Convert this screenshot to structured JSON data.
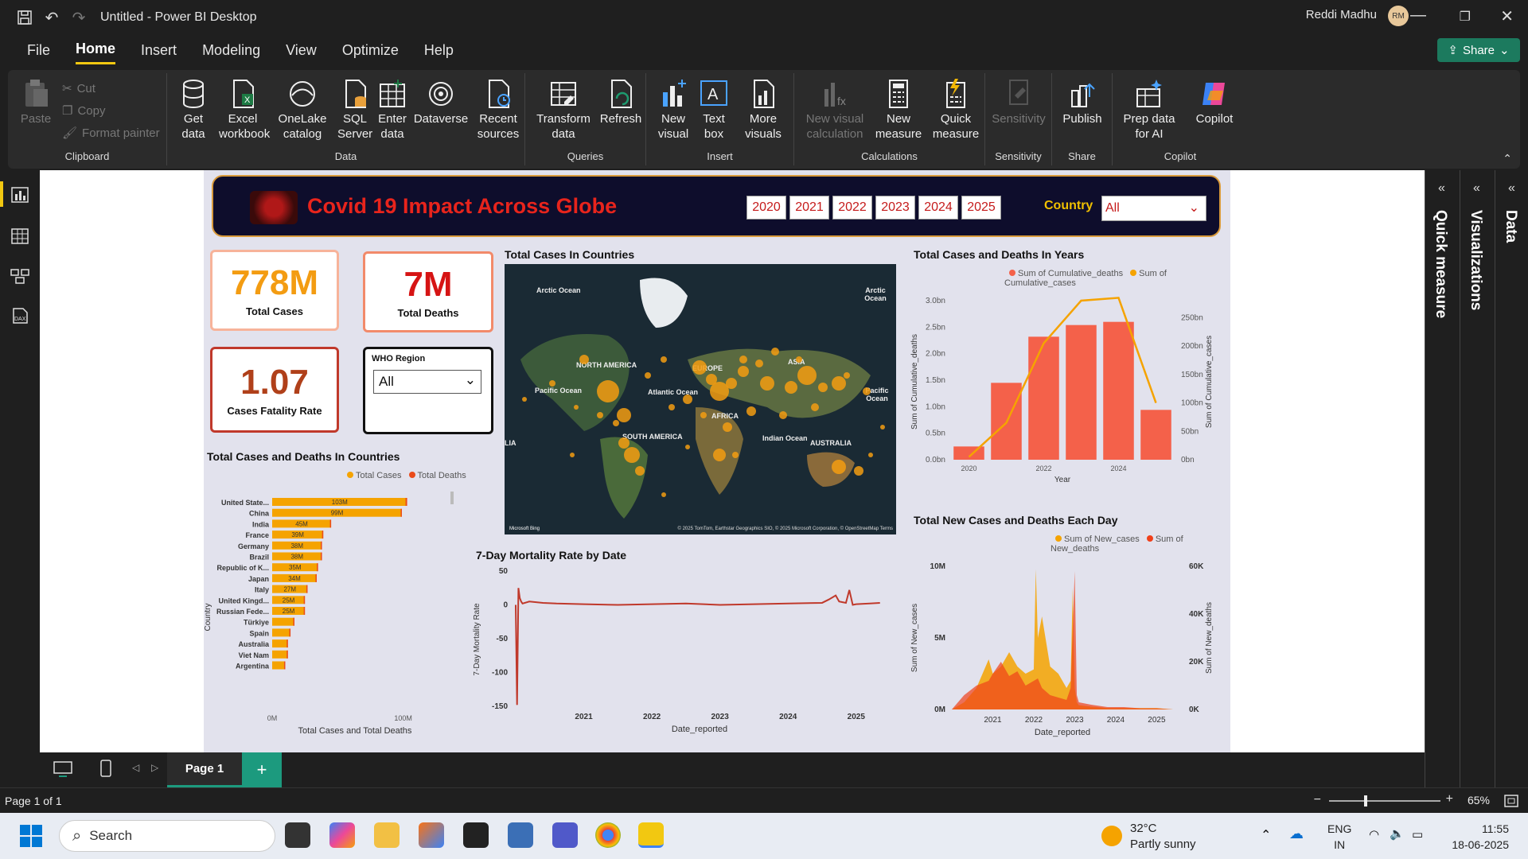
{
  "window": {
    "title": "Untitled - Power BI Desktop",
    "user": "Reddi Madhu",
    "initials": "RM"
  },
  "menu": [
    "File",
    "Home",
    "Insert",
    "Modeling",
    "View",
    "Optimize",
    "Help"
  ],
  "share_label": "Share",
  "ribbon": {
    "clipboard": {
      "paste": "Paste",
      "cut": "Cut",
      "copy": "Copy",
      "format_painter": "Format painter",
      "label": "Clipboard"
    },
    "data": {
      "get_data": "Get data",
      "excel": "Excel workbook",
      "onelake": "OneLake catalog",
      "sql": "SQL Server",
      "enter": "Enter data",
      "dataverse": "Dataverse",
      "recent": "Recent sources",
      "label": "Data"
    },
    "queries": {
      "transform": "Transform data",
      "refresh": "Refresh",
      "label": "Queries"
    },
    "insert": {
      "new_visual": "New visual",
      "text_box": "Text box",
      "more_visuals": "More visuals",
      "label": "Insert"
    },
    "calculations": {
      "new_visual_calc": "New visual calculation",
      "new_measure": "New measure",
      "quick_measure": "Quick measure",
      "label": "Calculations"
    },
    "sensitivity": {
      "btn": "Sensitivity",
      "label": "Sensitivity"
    },
    "share": {
      "publish": "Publish",
      "label": "Share"
    },
    "copilot": {
      "prep": "Prep data for AI",
      "copilot": "Copilot",
      "label": "Copilot"
    }
  },
  "panes": [
    "Quick measure",
    "Visualizations",
    "Data"
  ],
  "report": {
    "title": "Covid 19 Impact Across Globe",
    "years": [
      "2020",
      "2021",
      "2022",
      "2023",
      "2024",
      "2025"
    ],
    "country_label": "Country",
    "country_value": "All",
    "cards": [
      {
        "value": "778M",
        "label": "Total Cases",
        "color": "#f39c12"
      },
      {
        "value": "7M",
        "label": "Total Deaths",
        "color": "#d61414"
      },
      {
        "value": "1.07",
        "label": "Cases Fatality Rate",
        "color": "#b0401a"
      }
    ],
    "who_label": "WHO Region",
    "who_value": "All",
    "map": {
      "title": "Total Cases In Countries",
      "labels": [
        "Arctic Ocean",
        "Arctic Ocean",
        "NORTH AMERICA",
        "EUROPE",
        "ASIA",
        "Pacific Ocean",
        "Atlantic Ocean",
        "Pacific Ocean",
        "AFRICA",
        "SOUTH AMERICA",
        "Indian Ocean",
        "AUSTRALIA",
        "LIA"
      ],
      "attribution": "© 2025 TomTom, Earthstar Geographics SIO, © 2025 Microsoft Corporation, © OpenStreetMap Terms",
      "bing": "Microsoft Bing"
    }
  },
  "chart_data": [
    {
      "type": "bar",
      "title": "Total Cases and Deaths In Countries",
      "orientation": "horizontal",
      "legend": [
        "Total Cases",
        "Total Deaths"
      ],
      "categories": [
        "United State...",
        "China",
        "India",
        "France",
        "Germany",
        "Brazil",
        "Republic of K...",
        "Japan",
        "Italy",
        "United Kingd...",
        "Russian Fede...",
        "Türkiye",
        "Spain",
        "Australia",
        "Viet Nam",
        "Argentina"
      ],
      "series": [
        {
          "name": "Total Cases",
          "values": [
            103,
            99,
            45,
            39,
            38,
            38,
            35,
            34,
            27,
            25,
            25,
            17,
            14,
            12,
            12,
            10
          ]
        },
        {
          "name": "Total Deaths",
          "values": [
            1.2,
            0.12,
            0.53,
            0.17,
            0.18,
            0.7,
            0.04,
            0.07,
            0.2,
            0.23,
            0.4,
            0.1,
            0.12,
            0.02,
            0.04,
            0.13
          ]
        }
      ],
      "data_labels": [
        "103M",
        "99M",
        "45M",
        "39M",
        "38M",
        "38M",
        "35M",
        "34M",
        "27M",
        "25M",
        "25M",
        "",
        "",
        "",
        "",
        ""
      ],
      "xlabel": "Total Cases and Total Deaths",
      "ylabel": "Country",
      "xticks": [
        "0M",
        "100M"
      ],
      "xlim": [
        0,
        130
      ],
      "colors": {
        "cases": "#f5a300",
        "deaths": "#ea4b1b"
      }
    },
    {
      "type": "bar",
      "title": "Total Cases and Deaths In Years",
      "legend": [
        "Sum of Cumulative_deaths",
        "Sum of Cumulative_cases"
      ],
      "categories": [
        2020,
        2021,
        2022,
        2023,
        2024,
        2025
      ],
      "series": [
        {
          "name": "Sum of Cumulative_deaths",
          "kind": "bar",
          "values": [
            0.25,
            1.45,
            2.32,
            2.54,
            2.6,
            0.94
          ]
        },
        {
          "name": "Sum of Cumulative_cases",
          "kind": "line",
          "values": [
            5,
            65,
            205,
            280,
            285,
            100
          ]
        }
      ],
      "xlabel": "Year",
      "ylabel": "Sum of Cumulative_deaths",
      "y2label": "Sum of Cumulative_cases",
      "xticks": [
        "2020",
        "2022",
        "2024"
      ],
      "yticks": [
        "0.0bn",
        "0.5bn",
        "1.0bn",
        "1.5bn",
        "2.0bn",
        "2.5bn",
        "3.0bn"
      ],
      "y2ticks": [
        "0bn",
        "50bn",
        "100bn",
        "150bn",
        "200bn",
        "250bn"
      ],
      "ylim": [
        0,
        3.0
      ],
      "y2lim": [
        0,
        280
      ],
      "colors": {
        "bar": "#f4614a",
        "line": "#f5a300"
      }
    },
    {
      "type": "line",
      "title": "7-Day Mortality Rate by Date",
      "xlabel": "Date_reported",
      "ylabel": "7-Day Mortality Rate",
      "xticks": [
        "2021",
        "2022",
        "2023",
        "2024",
        "2025"
      ],
      "yticks": [
        "50",
        "0",
        "-50",
        "-100",
        "-150"
      ],
      "ylim": [
        -150,
        50
      ],
      "x": [
        2020.0,
        2020.02,
        2020.04,
        2020.06,
        2020.08,
        2020.1,
        2020.2,
        2020.4,
        2020.6,
        2021.0,
        2021.5,
        2022.0,
        2022.5,
        2023.0,
        2023.5,
        2024.0,
        2024.5,
        2024.6,
        2024.7,
        2024.75,
        2024.8,
        2024.85,
        2024.9,
        2024.95,
        2025.0,
        2025.2,
        2025.35
      ],
      "y": [
        0,
        -148,
        25,
        10,
        5,
        2,
        5,
        3,
        2,
        1,
        0,
        1,
        2,
        0,
        1,
        2,
        3,
        8,
        14,
        5,
        4,
        3,
        22,
        0,
        1,
        2,
        3
      ],
      "color": "#c0392b"
    },
    {
      "type": "area",
      "title": "Total New Cases and Deaths Each Day",
      "legend": [
        "Sum of New_cases",
        "Sum of New_deaths"
      ],
      "xlabel": "Date_reported",
      "ylabel": "Sum of New_cases",
      "y2label": "Sum of New_deaths",
      "xticks": [
        "2021",
        "2022",
        "2023",
        "2024",
        "2025"
      ],
      "yticks": [
        "0M",
        "5M",
        "10M"
      ],
      "y2ticks": [
        "0K",
        "20K",
        "40K",
        "60K"
      ],
      "ylim": [
        0,
        10
      ],
      "y2lim": [
        0,
        60
      ],
      "series": [
        {
          "name": "Sum of New_cases",
          "x": [
            2020.0,
            2020.3,
            2020.6,
            2020.9,
            2021.0,
            2021.2,
            2021.4,
            2021.6,
            2021.8,
            2022.0,
            2022.05,
            2022.1,
            2022.2,
            2022.4,
            2022.6,
            2022.8,
            2022.9,
            2022.95,
            2023.0,
            2023.05,
            2023.1,
            2023.4,
            2023.8,
            2024.2,
            2024.6,
            2025.0,
            2025.4
          ],
          "values": [
            0,
            0.5,
            1.5,
            3.5,
            2.5,
            3.0,
            4.0,
            3.0,
            2.5,
            2.8,
            9.8,
            5.0,
            6.5,
            3.0,
            2.5,
            1.5,
            2.0,
            8.5,
            1.5,
            0.5,
            0.3,
            0.2,
            0.1,
            0.1,
            0.1,
            0.1,
            0.0
          ]
        },
        {
          "name": "Sum of New_deaths",
          "x": [
            2020.0,
            2020.3,
            2020.6,
            2020.9,
            2021.0,
            2021.2,
            2021.4,
            2021.6,
            2021.8,
            2022.0,
            2022.1,
            2022.2,
            2022.4,
            2022.6,
            2022.8,
            2022.9,
            2023.0,
            2023.05,
            2023.1,
            2023.4,
            2023.8,
            2024.2,
            2024.6,
            2025.0,
            2025.4
          ],
          "values": [
            0,
            6,
            10,
            12,
            15,
            20,
            14,
            16,
            10,
            12,
            13,
            9,
            6,
            5,
            4,
            9,
            58,
            6,
            3,
            2,
            1,
            1,
            0.5,
            0.5,
            0
          ]
        }
      ],
      "colors": {
        "cases": "#f5a300",
        "deaths": "#f0401a"
      }
    }
  ],
  "tabs": {
    "page1": "Page 1"
  },
  "status": {
    "page_of": "Page 1 of 1",
    "zoom": "65%"
  },
  "taskbar": {
    "search": "Search",
    "temp": "32°C",
    "weather": "Partly sunny",
    "lang1": "ENG",
    "lang2": "IN",
    "time": "11:55",
    "date": "18-06-2025"
  }
}
